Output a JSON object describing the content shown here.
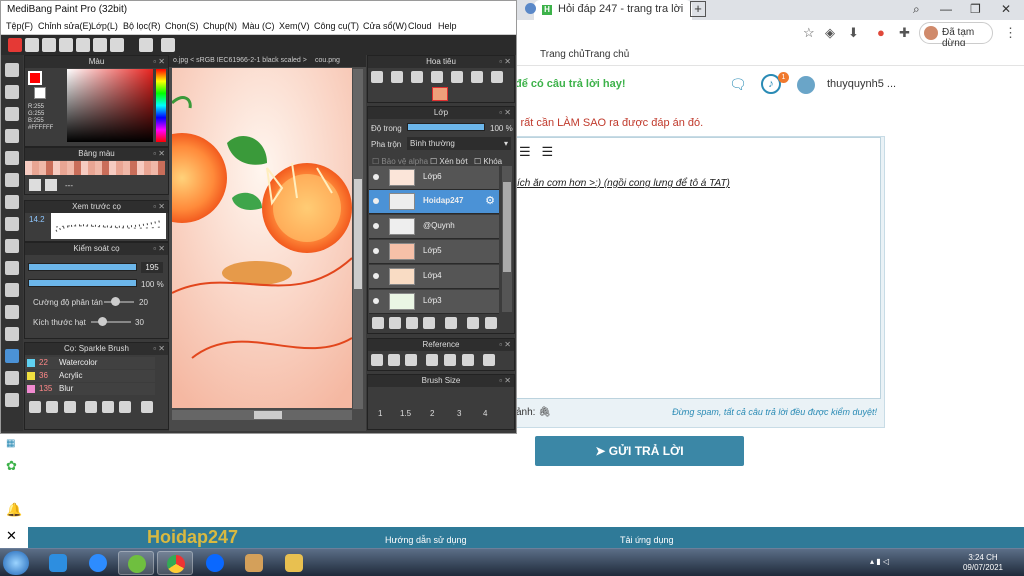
{
  "browser": {
    "tab_title": "Hỏi đáp 247 - trang tra lời",
    "tab_favicon": "H",
    "new_tab": "+",
    "bookmark": "Trang chủTrang chủ",
    "profile_label": "Đã tạm dừng",
    "win_min": "—",
    "win_max": "❐",
    "win_close": "✕"
  },
  "page": {
    "promo": "để có câu trả lời hay!",
    "notify_count": "1",
    "username": "thuyquynh5 ...",
    "question": "i rất cần LÀM SAO ra được đáp án đó.",
    "answer": "ích ăn cơm hơn >:)  (ngồi cong lưng để tô á TAT)",
    "attach_label": "ảnh:",
    "spam_note": "Đừng spam, tất cả câu trả lời đều được kiểm duyệt!",
    "submit_label": "GỬI TRẢ LỜI",
    "footer_brand": "Hoidap247",
    "footer_text1": "Hướng dẫn sử dụng",
    "footer_text2": "Tải ứng dụng"
  },
  "medibang": {
    "title": "MediBang Paint Pro (32bit)",
    "menu": [
      "Tệp(F)",
      "Chỉnh sửa(E)",
      "Lớp(L)",
      "Bộ lọc(R)",
      "Chọn(S)",
      "Chụp(N)",
      "Màu (C)",
      "Xem(V)",
      "Công cụ(T)",
      "Cửa sổ(W)",
      "Cloud",
      "Help"
    ],
    "panel_color": "Màu",
    "rgb_r": "R:255",
    "rgb_g": "G:255",
    "rgb_b": "B:255",
    "hex": "#FFFFFF",
    "panel_palette": "Bảng màu",
    "palette_dots": "---",
    "panel_brush_preview": "Xem trước cọ",
    "brush_size_label": "14.2",
    "panel_brush_control": "Kiểm soát cọ",
    "size_value": "195",
    "opacity_value": "100 %",
    "scatter_label": "Cường độ phân tán",
    "scatter_value": "20",
    "particle_label": "Kích thước hạt",
    "particle_value": "30",
    "panel_brush_list": "Cọ: Sparkle Brush",
    "brushes": [
      {
        "num": "22",
        "name": "Watercolor",
        "color": "#5fd0f0"
      },
      {
        "num": "36",
        "name": "Acrylic",
        "color": "#f0e040"
      },
      {
        "num": "135",
        "name": "Blur",
        "color": "#f08ad0"
      }
    ],
    "canvas_tab1": "o.jpg < sRGB IEC61966-2-1 black scaled >",
    "canvas_tab2": "cou.png",
    "panel_navigator": "Hoa tiêu",
    "panel_layer": "Lớp",
    "opacity_label": "Độ trong",
    "layer_opacity": "100 %",
    "blend_label": "Pha trộn",
    "blend_value": "Bình thường",
    "protect_alpha": "Bảo vệ alpha",
    "clip": "Xén bớt",
    "lock": "Khóa",
    "layers": [
      {
        "name": "Lớp6",
        "selected": false
      },
      {
        "name": "Hoidap247",
        "selected": true
      },
      {
        "name": "@Quynh",
        "selected": false
      },
      {
        "name": "Lớp5",
        "selected": false
      },
      {
        "name": "Lớp4",
        "selected": false
      },
      {
        "name": "Lớp3",
        "selected": false
      }
    ],
    "panel_reference": "Reference",
    "panel_brush_size": "Brush Size",
    "brush_sizes": [
      "1",
      "1.5",
      "2",
      "3",
      "4"
    ]
  },
  "taskbar": {
    "time": "3:24 CH",
    "date": "09/07/2021"
  },
  "colors": {
    "accent_blue": "#3b87a6",
    "layer_selected": "#4b92d6",
    "promo_green": "#3db24a"
  }
}
